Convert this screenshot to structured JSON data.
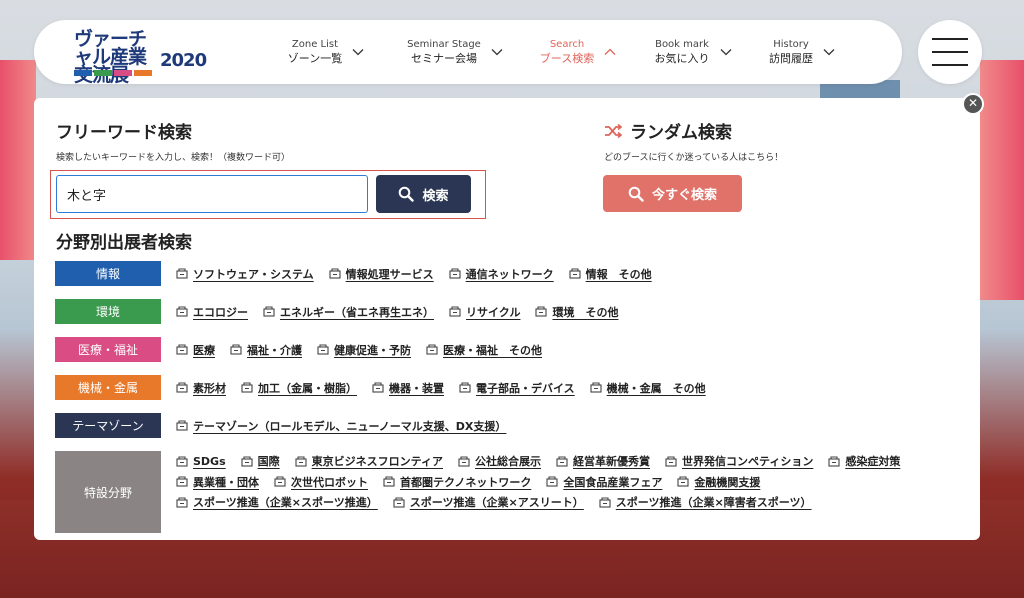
{
  "logo": {
    "title": "ヴァーチャル産業交流展",
    "year": "2020",
    "tag_colors": [
      "#1f5fae",
      "#3a9a4e",
      "#d94c84",
      "#e8792a"
    ]
  },
  "nav": {
    "items": [
      {
        "en": "Zone List",
        "jp": "ゾーン一覧",
        "active": false
      },
      {
        "en": "Seminar Stage",
        "jp": "セミナー会場",
        "active": false
      },
      {
        "en": "Search",
        "jp": "ブース検索",
        "active": true
      },
      {
        "en": "Book mark",
        "jp": "お気に入り",
        "active": false
      },
      {
        "en": "History",
        "jp": "訪問履歴",
        "active": false
      }
    ],
    "menu_icon": "hamburger-icon"
  },
  "panel": {
    "close_icon": "close-icon",
    "close_glyph": "✕",
    "free": {
      "heading": "フリーワード検索",
      "sub": "検索したいキーワードを入力し、検索！（複数ワード可）",
      "input_value": "木と字",
      "button_label": "検索",
      "button_icon": "search-icon"
    },
    "random": {
      "heading": "ランダム検索",
      "heading_icon": "shuffle-icon",
      "sub": "どのブースに行くか迷っている人はこちら！",
      "button_label": "今すぐ検索",
      "button_icon": "search-icon"
    },
    "category": {
      "heading": "分野別出展者検索",
      "rows": [
        {
          "label": "情報",
          "color": "#1f5fae",
          "links": [
            "ソフトウェア・システム",
            "情報処理サービス",
            "通信ネットワーク",
            "情報　その他"
          ]
        },
        {
          "label": "環境",
          "color": "#3a9a4e",
          "links": [
            "エコロジー",
            "エネルギー（省エネ再生エネ）",
            "リサイクル",
            "環境　その他"
          ]
        },
        {
          "label": "医療・福祉",
          "color": "#d94c84",
          "links": [
            "医療",
            "福祉・介護",
            "健康促進・予防",
            "医療・福祉　その他"
          ]
        },
        {
          "label": "機械・金属",
          "color": "#e8792a",
          "links": [
            "素形材",
            "加工（金属・樹脂）",
            "機器・装置",
            "電子部品・デバイス",
            "機械・金属　その他"
          ]
        },
        {
          "label": "テーマゾーン",
          "color": "#2a3653",
          "links": [
            "テーマゾーン（ロールモデル、ニューノーマル支援、DX支援）"
          ]
        },
        {
          "label": "特設分野",
          "color": "#8a8584",
          "links": [
            "SDGs",
            "国際",
            "東京ビジネスフロンティア",
            "公社総合展示",
            "経営革新優秀賞",
            "世界発信コンペティション",
            "感染症対策",
            "異業種・団体",
            "次世代ロボット",
            "首都圏テクノネットワーク",
            "全国食品産業フェア",
            "金融機関支援",
            "スポーツ推進（企業×スポーツ推進）",
            "スポーツ推進（企業×アスリート）",
            "スポーツ推進（企業×障害者スポーツ）"
          ]
        }
      ],
      "link_icon": "booth-icon"
    }
  }
}
